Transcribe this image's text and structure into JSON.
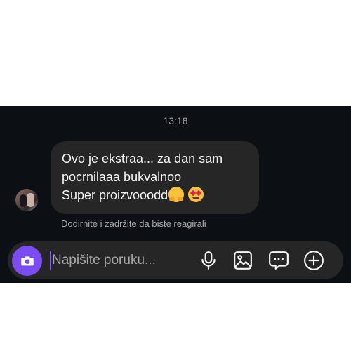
{
  "chat": {
    "timestamp": "13:18",
    "message": {
      "lines": [
        "Ovo je ekstraa... za dan sam",
        "pocrnilaaa bukvalnoo",
        "Super proizvooodd"
      ],
      "emojis": [
        "hugging-face",
        "heart-eyes"
      ]
    },
    "hint": "Dodirnite i zadržite da biste reagirali"
  },
  "composer": {
    "placeholder": "Napišite poruku...",
    "accent": "#7b4cf4",
    "icons": [
      "camera-icon",
      "microphone-icon",
      "image-icon",
      "sticker-icon",
      "plus-icon"
    ]
  },
  "colors": {
    "background": "#0c1014",
    "bubble": "#262626",
    "text": "#f5f5f5",
    "muted": "#a8a8a8"
  }
}
